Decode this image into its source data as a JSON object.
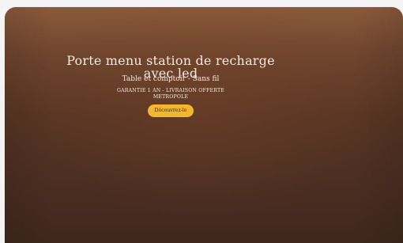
{
  "hero": {
    "title": "Porte menu station de recharge avec led",
    "subtitle": "Table et comptoir - Sans fil",
    "line1": "GARANTIE 1 AN - LIVRAISON OFFERTE",
    "line2": "METROPOLE",
    "cta": "Découvrez-le",
    "colors": {
      "cta_bg": "#f2b72e"
    }
  }
}
